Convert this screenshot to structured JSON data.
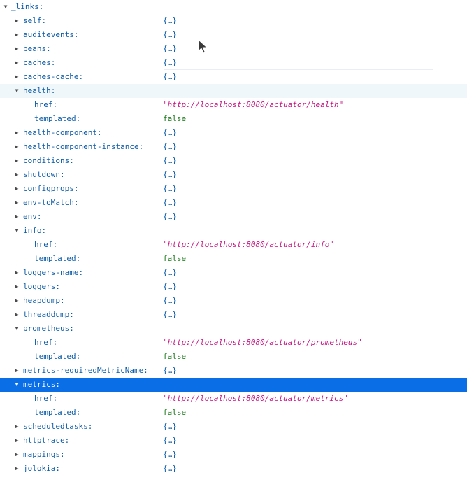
{
  "json_viewer": {
    "root_key": "_links:",
    "rows": [
      {
        "key": "self:",
        "value": "{…}"
      },
      {
        "key": "auditevents:",
        "value": "{…}"
      },
      {
        "key": "beans:",
        "value": "{…}"
      },
      {
        "key": "caches:",
        "value": "{…}"
      },
      {
        "key": "caches-cache:",
        "value": "{…}"
      },
      {
        "key": "health:",
        "value": ""
      },
      {
        "key": "href:",
        "value": "\"http://localhost:8080/actuator/health\""
      },
      {
        "key": "templated:",
        "value": "false"
      },
      {
        "key": "health-component:",
        "value": "{…}"
      },
      {
        "key": "health-component-instance:",
        "value": "{…}"
      },
      {
        "key": "conditions:",
        "value": "{…}"
      },
      {
        "key": "shutdown:",
        "value": "{…}"
      },
      {
        "key": "configprops:",
        "value": "{…}"
      },
      {
        "key": "env-toMatch:",
        "value": "{…}"
      },
      {
        "key": "env:",
        "value": "{…}"
      },
      {
        "key": "info:",
        "value": ""
      },
      {
        "key": "href:",
        "value": "\"http://localhost:8080/actuator/info\""
      },
      {
        "key": "templated:",
        "value": "false"
      },
      {
        "key": "loggers-name:",
        "value": "{…}"
      },
      {
        "key": "loggers:",
        "value": "{…}"
      },
      {
        "key": "heapdump:",
        "value": "{…}"
      },
      {
        "key": "threaddump:",
        "value": "{…}"
      },
      {
        "key": "prometheus:",
        "value": ""
      },
      {
        "key": "href:",
        "value": "\"http://localhost:8080/actuator/prometheus\""
      },
      {
        "key": "templated:",
        "value": "false"
      },
      {
        "key": "metrics-requiredMetricName:",
        "value": "{…}"
      },
      {
        "key": "metrics:",
        "value": ""
      },
      {
        "key": "href:",
        "value": "\"http://localhost:8080/actuator/metrics\""
      },
      {
        "key": "templated:",
        "value": "false"
      },
      {
        "key": "scheduledtasks:",
        "value": "{…}"
      },
      {
        "key": "httptrace:",
        "value": "{…}"
      },
      {
        "key": "mappings:",
        "value": "{…}"
      },
      {
        "key": "jolokia:",
        "value": "{…}"
      }
    ]
  },
  "icons": {
    "expanded": "▼",
    "collapsed": "▶",
    "cursor": "mouse-pointer-icon"
  },
  "colors": {
    "key": "#0b5ca8",
    "string": "#c71585",
    "boolean": "#1c7a1c",
    "selected_row": "#0a6ee6",
    "hover_row": "#f0f7fb"
  }
}
